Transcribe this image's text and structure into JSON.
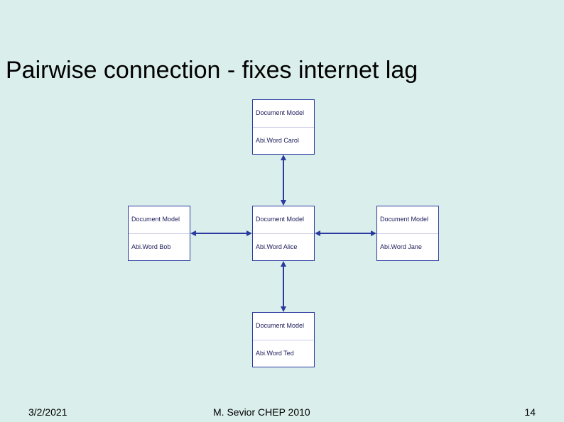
{
  "title": "Pairwise connection - fixes internet lag",
  "nodes": {
    "carol": {
      "doc": "Document Model",
      "client": "Abi.Word Carol"
    },
    "bob": {
      "doc": "Document Model",
      "client": "Abi.Word Bob"
    },
    "alice": {
      "doc": "Document Model",
      "client": "Abi.Word Alice"
    },
    "jane": {
      "doc": "Document Model",
      "client": "Abi.Word Jane"
    },
    "ted": {
      "doc": "Document Model",
      "client": "Abi.Word Ted"
    }
  },
  "footer": {
    "date": "3/2/2021",
    "author": "M. Sevior CHEP 2010",
    "page": "14"
  }
}
